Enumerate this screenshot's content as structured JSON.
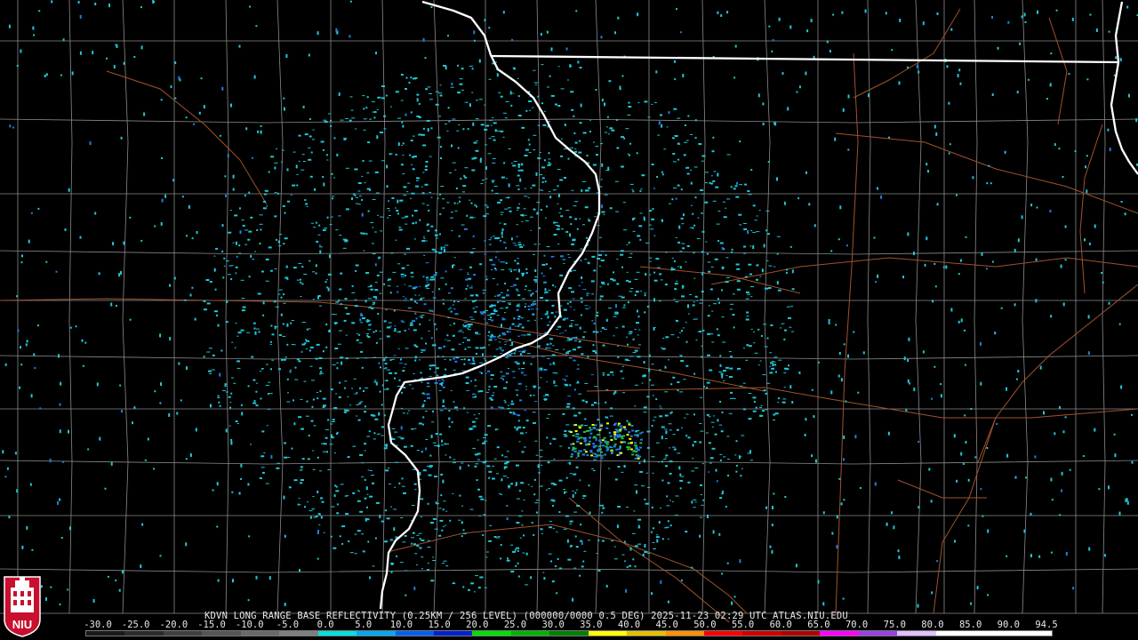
{
  "product": {
    "title": "KDVN LONG RANGE BASE REFLECTIVITY (0.25KM / 256 LEVEL) (000000/0000 0.5 DEG) 2025-11-23 02:29 UTC  ATLAS.NIU.EDU"
  },
  "color_scale": {
    "labels": [
      "-30.0",
      "-25.0",
      "-20.0",
      "-15.0",
      "-10.0",
      "-5.0",
      "0.0",
      "5.0",
      "10.0",
      "15.0",
      "20.0",
      "25.0",
      "30.0",
      "35.0",
      "40.0",
      "45.0",
      "50.0",
      "55.0",
      "60.0",
      "65.0",
      "70.0",
      "75.0",
      "80.0",
      "85.0",
      "90.0",
      "94.5"
    ],
    "colors": [
      "#1a1a1a",
      "#2c2c2c",
      "#404040",
      "#555555",
      "#6a6a6a",
      "#7f7f7f",
      "#00e0e0",
      "#00a8f0",
      "#0060f0",
      "#0020d0",
      "#00e000",
      "#00b400",
      "#008000",
      "#ffff00",
      "#e6c000",
      "#ff9000",
      "#ff0000",
      "#d00000",
      "#b00000",
      "#ff00ff",
      "#9a40e0",
      "#e0c0ff",
      "#ffffff",
      "#ffffff",
      "#ffffff"
    ]
  },
  "logo": {
    "text": "NIU",
    "primary_color": "#c8102e"
  },
  "map": {
    "background_color": "#000000",
    "state_border_color": "#ffffff",
    "county_border_color": "#8a8a8a",
    "highway_color": "#a0522d",
    "echo_colors": {
      "clutter": "#1fc8d8",
      "weak": "#1f7fe0",
      "moderate": "#1fbf3f",
      "strong": "#ffff00"
    }
  }
}
